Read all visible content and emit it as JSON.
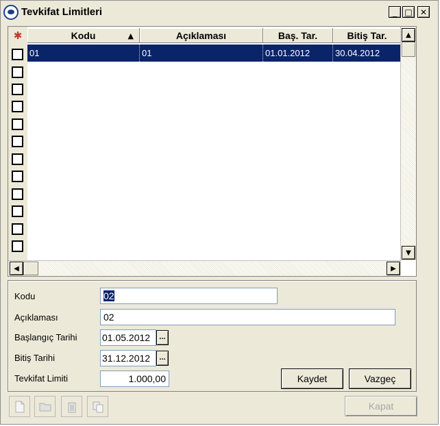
{
  "window": {
    "title": "Tevkifat Limitleri",
    "minimize_label": "_",
    "maximize_label": "□",
    "close_label": "✕"
  },
  "grid": {
    "select_all_icon": "✱",
    "columns": [
      "Kodu",
      "Açıklaması",
      "Baş. Tar.",
      "Bitiş Tar."
    ],
    "sorted_column": "Kodu",
    "sort_direction": "ascending",
    "sort_arrow": "▲",
    "rows": [
      {
        "kodu": "01",
        "aciklamasi": "01",
        "bas_tar": "01.01.2012",
        "bitis_tar": "30.04.2012",
        "selected": true
      }
    ],
    "scroll_up": "▲",
    "scroll_down": "▼",
    "scroll_left": "◀",
    "scroll_right": "▶"
  },
  "form": {
    "kodu_label": "Kodu",
    "kodu_value": "02",
    "aciklamasi_label": "Açıklaması",
    "aciklamasi_value": "02",
    "baslangic_label": "Başlangıç Tarihi",
    "baslangic_value": "01.05.2012",
    "bitis_label": "Bitiş Tarihi",
    "bitis_value": "31.12.2012",
    "limit_label": "Tevkifat Limiti",
    "limit_value": "1.000,00",
    "picker_label": "...",
    "kaydet_label": "Kaydet",
    "vazgec_label": "Vazgeç"
  },
  "toolbar": {
    "icons": [
      "new-document-icon",
      "open-folder-icon",
      "delete-trash-icon",
      "copy-icon"
    ],
    "kapat_label": "Kapat"
  },
  "colors": {
    "selection": "#0a246a",
    "face": "#ece9d8"
  }
}
